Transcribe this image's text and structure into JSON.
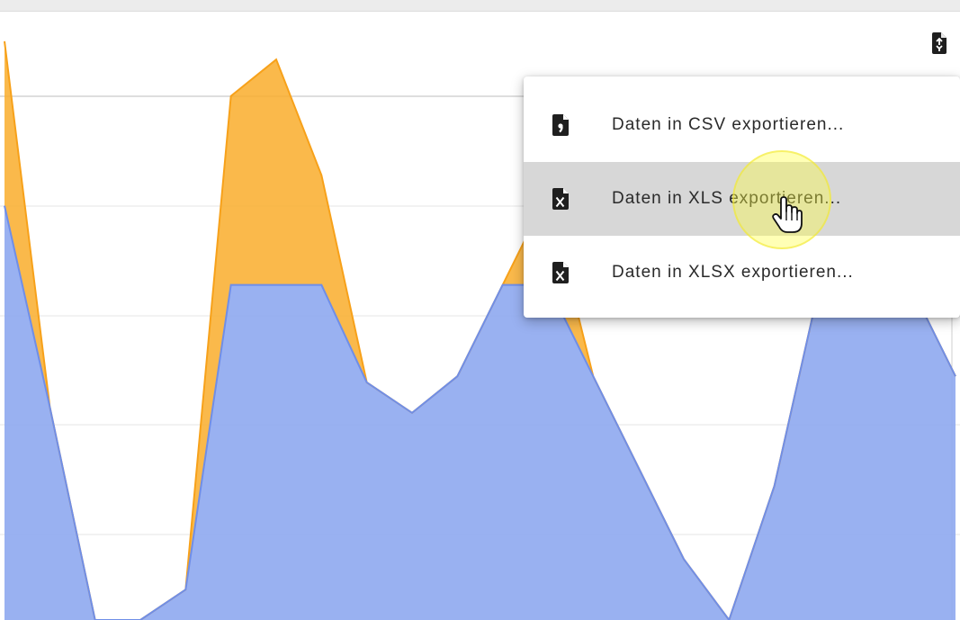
{
  "toolbar": {
    "export_icon": "file-export-icon"
  },
  "export_menu": {
    "items": [
      {
        "label": "Daten in CSV exportieren...",
        "icon": "file-csv-icon",
        "state": "normal"
      },
      {
        "label": "Daten in XLS exportieren...",
        "icon": "file-excel-icon",
        "state": "hovered"
      },
      {
        "label": "Daten in XLSX exportieren...",
        "icon": "file-excel-icon",
        "state": "normal"
      }
    ]
  },
  "cursor": {
    "icon": "hand-pointer-icon",
    "highlight": "yellow-click-highlight"
  },
  "colors": {
    "series_orange": "#f9ad2c",
    "series_orange_line": "#f7a11a",
    "series_blue": "#8ea8f0",
    "series_blue_line": "#6f8ee8",
    "menu_hover": "#d7d7d7",
    "gridline": "#e6e6e6"
  },
  "chart_data": {
    "type": "area",
    "stacked": true,
    "grid": true,
    "x": [
      0,
      1,
      2,
      3,
      4,
      5,
      6,
      7,
      8,
      9,
      10,
      11,
      12,
      13,
      14,
      15,
      16,
      17,
      18,
      19,
      20,
      21
    ],
    "series": [
      {
        "values": [
          0.68,
          0.35,
          0.0,
          0.0,
          0.05,
          0.55,
          0.55,
          0.55,
          0.39,
          0.34,
          0.4,
          0.55,
          0.55,
          0.4,
          0.25,
          0.1,
          0.0,
          0.22,
          0.55,
          0.55,
          0.55,
          0.4
        ]
      },
      {
        "values": [
          0.27,
          0.0,
          0.0,
          0.0,
          0.0,
          0.31,
          0.37,
          0.18,
          0.0,
          0.0,
          0.0,
          0.0,
          0.15,
          0.0,
          0.0,
          0.0,
          0.0,
          0.0,
          0.0,
          0.14,
          0.0,
          0.0
        ]
      }
    ]
  }
}
